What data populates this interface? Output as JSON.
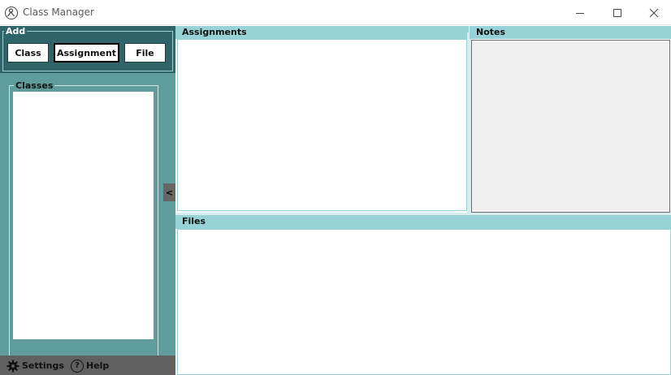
{
  "window": {
    "title": "Class Manager",
    "controls": [
      "minimize",
      "maximize",
      "close"
    ]
  },
  "sidebar": {
    "add_label": "Add",
    "buttons": {
      "class": "Class",
      "assignment": "Assignment",
      "file": "File"
    },
    "classes_label": "Classes",
    "collapse_label": "<",
    "footer": {
      "settings": "Settings",
      "help": "Help",
      "help_glyph": "?"
    }
  },
  "main": {
    "assignments_label": "Assignments",
    "notes_label": "Notes",
    "files_label": "Files"
  },
  "colors": {
    "sidebar": "#5f9d9d",
    "add_section": "#2f6468",
    "panel_header": "#97d3d6",
    "footer": "#606060"
  }
}
